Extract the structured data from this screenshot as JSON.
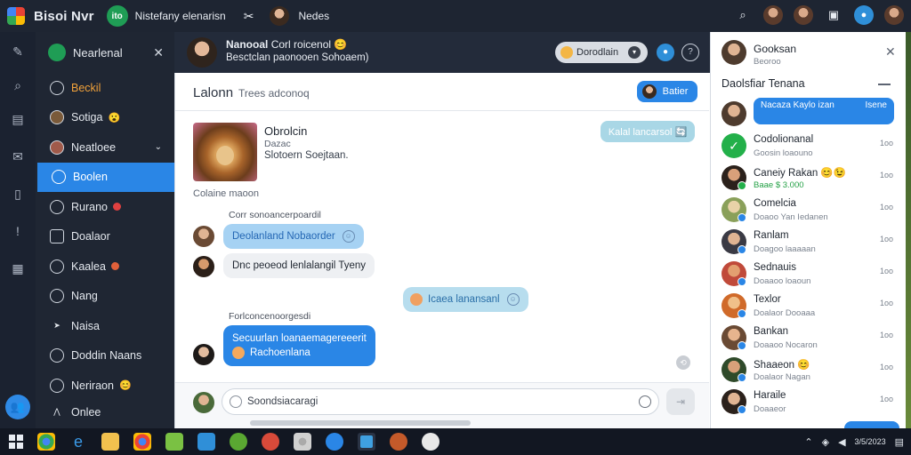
{
  "topbar": {
    "app_title": "Bisoi Nvr",
    "badge": "ito",
    "subtitle": "Nistefany elenarisn",
    "user_name": "Nedes"
  },
  "sidebar": {
    "header": "Nearlenal",
    "items": [
      {
        "label": "Beckil",
        "style": "orange"
      },
      {
        "label": "Sotiga",
        "emoji": "😮"
      },
      {
        "label": "Neatloee",
        "has_chevron": true
      },
      {
        "label": "Boolen",
        "active": true
      },
      {
        "label": "Rurano",
        "has_dot": true
      },
      {
        "label": "Doalaor"
      },
      {
        "label": "Kaalea",
        "has_dot": true
      },
      {
        "label": "Nang"
      },
      {
        "label": "Naisa"
      },
      {
        "label": "Doddin Naans"
      },
      {
        "label": "Neriraon",
        "emoji": "😊"
      },
      {
        "label": "Onlee"
      }
    ]
  },
  "chat_header": {
    "title": "Nanooal",
    "title_extra": "Corl roicenol 😊",
    "subtitle": "Besctclan paonooen Sohoaem)",
    "pill_label": "Dorodlain"
  },
  "chat": {
    "title": "Lalonn",
    "title_sub": "Trees adconoq",
    "title_button": "Batier",
    "card": {
      "name": "Obrolcin",
      "meta": "Dazac",
      "desc": "Slotoern Soejtaan.",
      "pill": "Kalal lancarsol 🔄",
      "footer": "Colaine maoon"
    },
    "messages": [
      {
        "label": "Corr sonoancerpoardil",
        "text": "Deolanland Nobaorder",
        "style": "light"
      },
      {
        "text": "Dnc peoeod lenlalangil Tyeny",
        "style": "grey"
      },
      {
        "text": "Icaea lanansanl",
        "style": "center"
      },
      {
        "label": "Forlconcenoorgesdi",
        "line1": "Secuurlan loanaemagereeerit",
        "line2": "Rachoenlana",
        "style": "blue"
      }
    ],
    "composer_placeholder": "Soondsiacaragi"
  },
  "right_panel": {
    "contact_name": "Gooksan",
    "contact_sub": "Beoroo",
    "section_title": "Daolsfiar Tenana",
    "preview_text": "Nacaza Kaylo izan",
    "preview_time": "Isene",
    "contacts": [
      {
        "name": "Codolionanal",
        "sub": "Goosin loaouno",
        "time": "1oo",
        "check": true
      },
      {
        "name": "Caneiy Rakan 😊😉",
        "sub": "Baae $ 3.000",
        "time": "1oo"
      },
      {
        "name": "Comelcia",
        "sub": "Doaoo Yan Iedanen",
        "time": "1oo"
      },
      {
        "name": "Ranlam",
        "sub": "Doagoo laaaaan",
        "time": "1oo"
      },
      {
        "name": "Sednauis",
        "sub": "Doaaoo loaoun",
        "time": "1oo"
      },
      {
        "name": "Texlor",
        "sub": "Doalaor Dooaaa",
        "time": "1oo"
      },
      {
        "name": "Bankan",
        "sub": "Doaaoo Nocaron",
        "time": "1oo"
      },
      {
        "name": "Shaaeon 😊",
        "sub": "Doalaor Nagan",
        "time": "1oo"
      },
      {
        "name": "Haraile",
        "sub": "Doaaeor",
        "time": "1oo"
      }
    ]
  },
  "taskbar": {
    "clock": "3/5/2023"
  }
}
